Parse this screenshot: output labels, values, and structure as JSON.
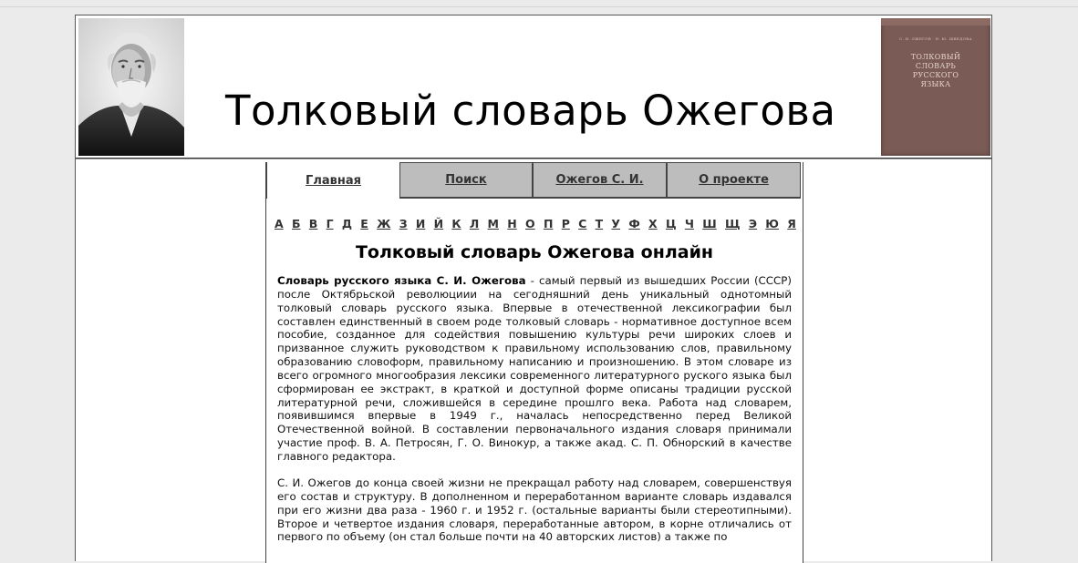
{
  "header": {
    "title": "Толковый словарь Ожегова",
    "book": {
      "authors": "С. И. ОЖЕГОВ · Н. Ю. ШВЕДОВА",
      "title_lines": [
        "ТОЛКОВЫЙ",
        "СЛОВАРЬ",
        "РУССКОГО",
        "ЯЗЫКА"
      ]
    }
  },
  "nav": {
    "tabs": [
      {
        "label": "Главная",
        "active": true
      },
      {
        "label": "Поиск",
        "active": false
      },
      {
        "label": "Ожегов С. И.",
        "active": false
      },
      {
        "label": "О проекте",
        "active": false
      }
    ]
  },
  "alphabet": [
    "А",
    "Б",
    "В",
    "Г",
    "Д",
    "Е",
    "Ж",
    "З",
    "И",
    "Й",
    "К",
    "Л",
    "М",
    "Н",
    "О",
    "П",
    "Р",
    "С",
    "Т",
    "У",
    "Ф",
    "Х",
    "Ц",
    "Ч",
    "Ш",
    "Щ",
    "Э",
    "Ю",
    "Я"
  ],
  "main": {
    "title": "Толковый словарь Ожегова онлайн",
    "p1_bold": "Словарь русского языка С. И. Ожегова",
    "p1_text": " - самый первый из вышедших России (СССР) после Октябрьской революциии на сегодняшний день уникальный однотомный толковый словарь русского языка. Впервые в отечественной лексикографии был составлен единственный в своем роде толковый словарь - нормативное доступное всем пособие, созданное для содействия повышению культуры речи широких слоев и призванное служить руководством к правильному использованию слов, правильному образованию словоформ, правильному написанию и произношению. В этом словаре из всего огромного многообразия лексики современного литературного руского языка был сформирован ее экстракт, в краткой и доступной форме описаны традиции русской литературной речи, сложившейся в середине прошлго века. Работа над словарем, появившимся впервые в 1949 г., началась непосредственно перед Великой Отечественной войной. В составлении первоначального издания словаря принимали участие проф. В. А. Петросян, Г. О. Винокур, а также акад. С. П. Обнорский в качестве главного редактора.",
    "p2_text": "С. И. Ожегов до конца своей жизни не прекращал работу над словарем, совершенствуя его состав и структуру. В дополненном и переработанном варианте словарь издавался при его жизни два раза - 1960 г. и 1952 г. (остальные варианты были стереотипными). Второе и четвертое издания словаря, переработанные автором, в корне отличались от первого по объему (он стал больше почти на 40 авторских листов) а также по"
  }
}
